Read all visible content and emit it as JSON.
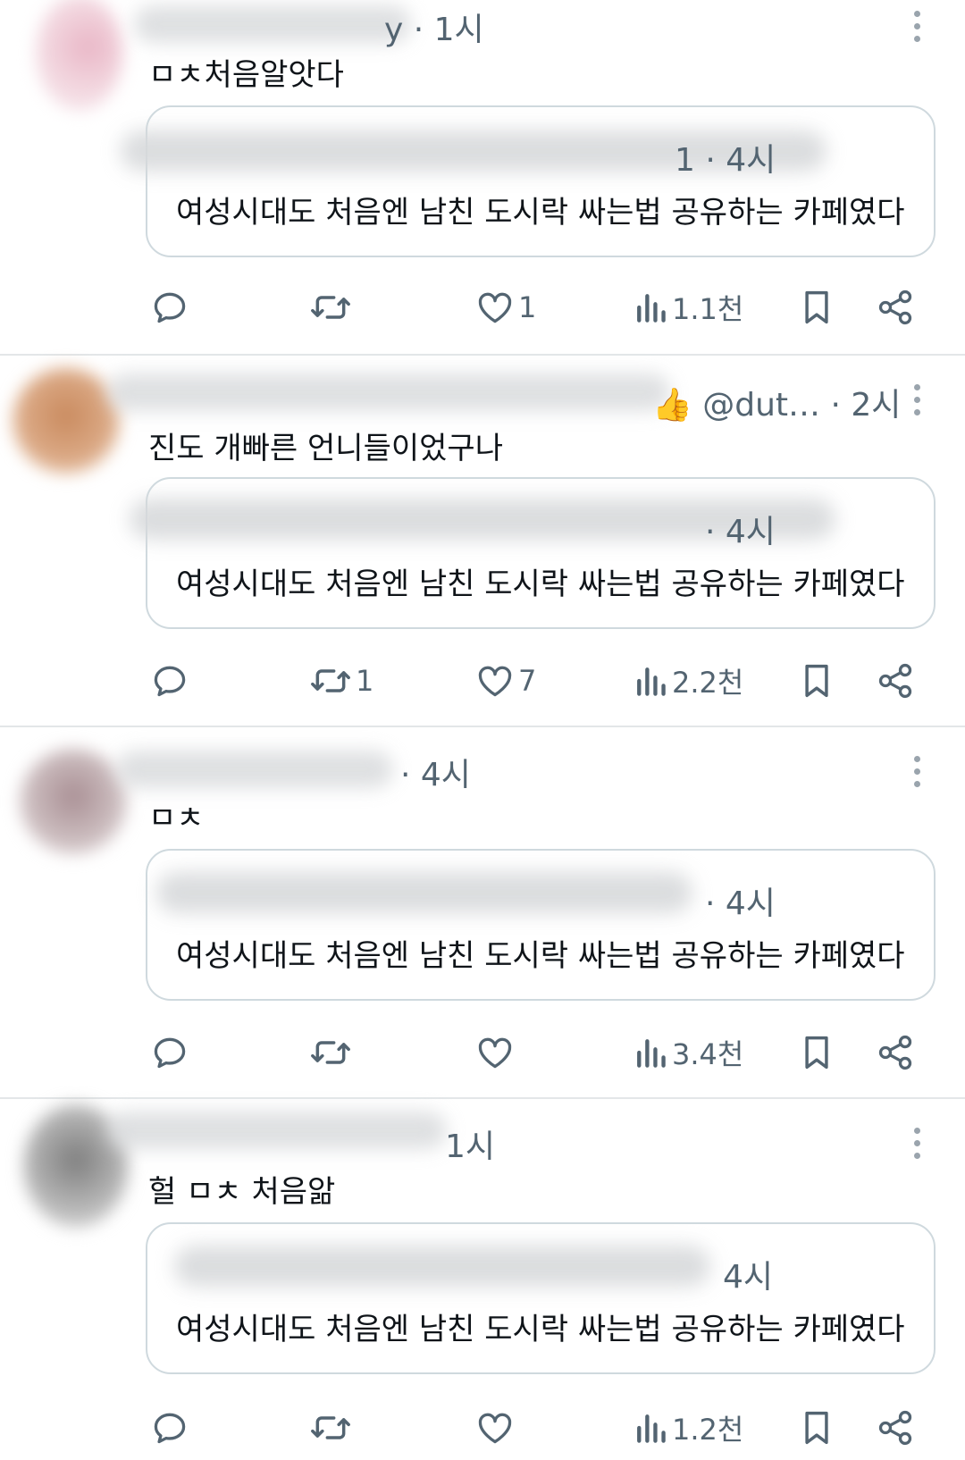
{
  "colors": {
    "text": "#0f1419",
    "muted": "#536471",
    "border": "#cfd9de",
    "divider": "#e3e6e8"
  },
  "posts": [
    {
      "meta_tail": "y · 1시",
      "text": "ㅁㅊ처음알앗다",
      "quote": {
        "time": "1 · 4시",
        "text": "여성시대도 처음엔 남친 도시락 싸는법 공유하는 카페였다"
      },
      "stats": {
        "replies": "",
        "reposts": "",
        "likes": "1",
        "views": "1.1천"
      }
    },
    {
      "meta_tail": "👍 @dut…  · 2시",
      "text": "진도 개빠른 언니들이었구나",
      "quote": {
        "time": "· 4시",
        "text": "여성시대도 처음엔 남친 도시락 싸는법 공유하는 카페였다"
      },
      "stats": {
        "replies": "",
        "reposts": "1",
        "likes": "7",
        "views": "2.2천"
      }
    },
    {
      "meta_tail": "· 4시",
      "text": "ㅁㅊ",
      "quote": {
        "time": "· 4시",
        "text": "여성시대도 처음엔 남친 도시락 싸는법 공유하는 카페였다"
      },
      "stats": {
        "replies": "",
        "reposts": "",
        "likes": "",
        "views": "3.4천"
      }
    },
    {
      "meta_tail": "1시",
      "text": "헐 ㅁㅊ 처음앎",
      "quote": {
        "time": "4시",
        "text": "여성시대도 처음엔 남친 도시락 싸는법 공유하는 카페였다"
      },
      "stats": {
        "replies": "",
        "reposts": "",
        "likes": "",
        "views": "1.2천"
      }
    }
  ],
  "icons": [
    "reply-icon",
    "repost-icon",
    "like-icon",
    "views-icon",
    "bookmark-icon",
    "share-icon",
    "more-icon"
  ]
}
